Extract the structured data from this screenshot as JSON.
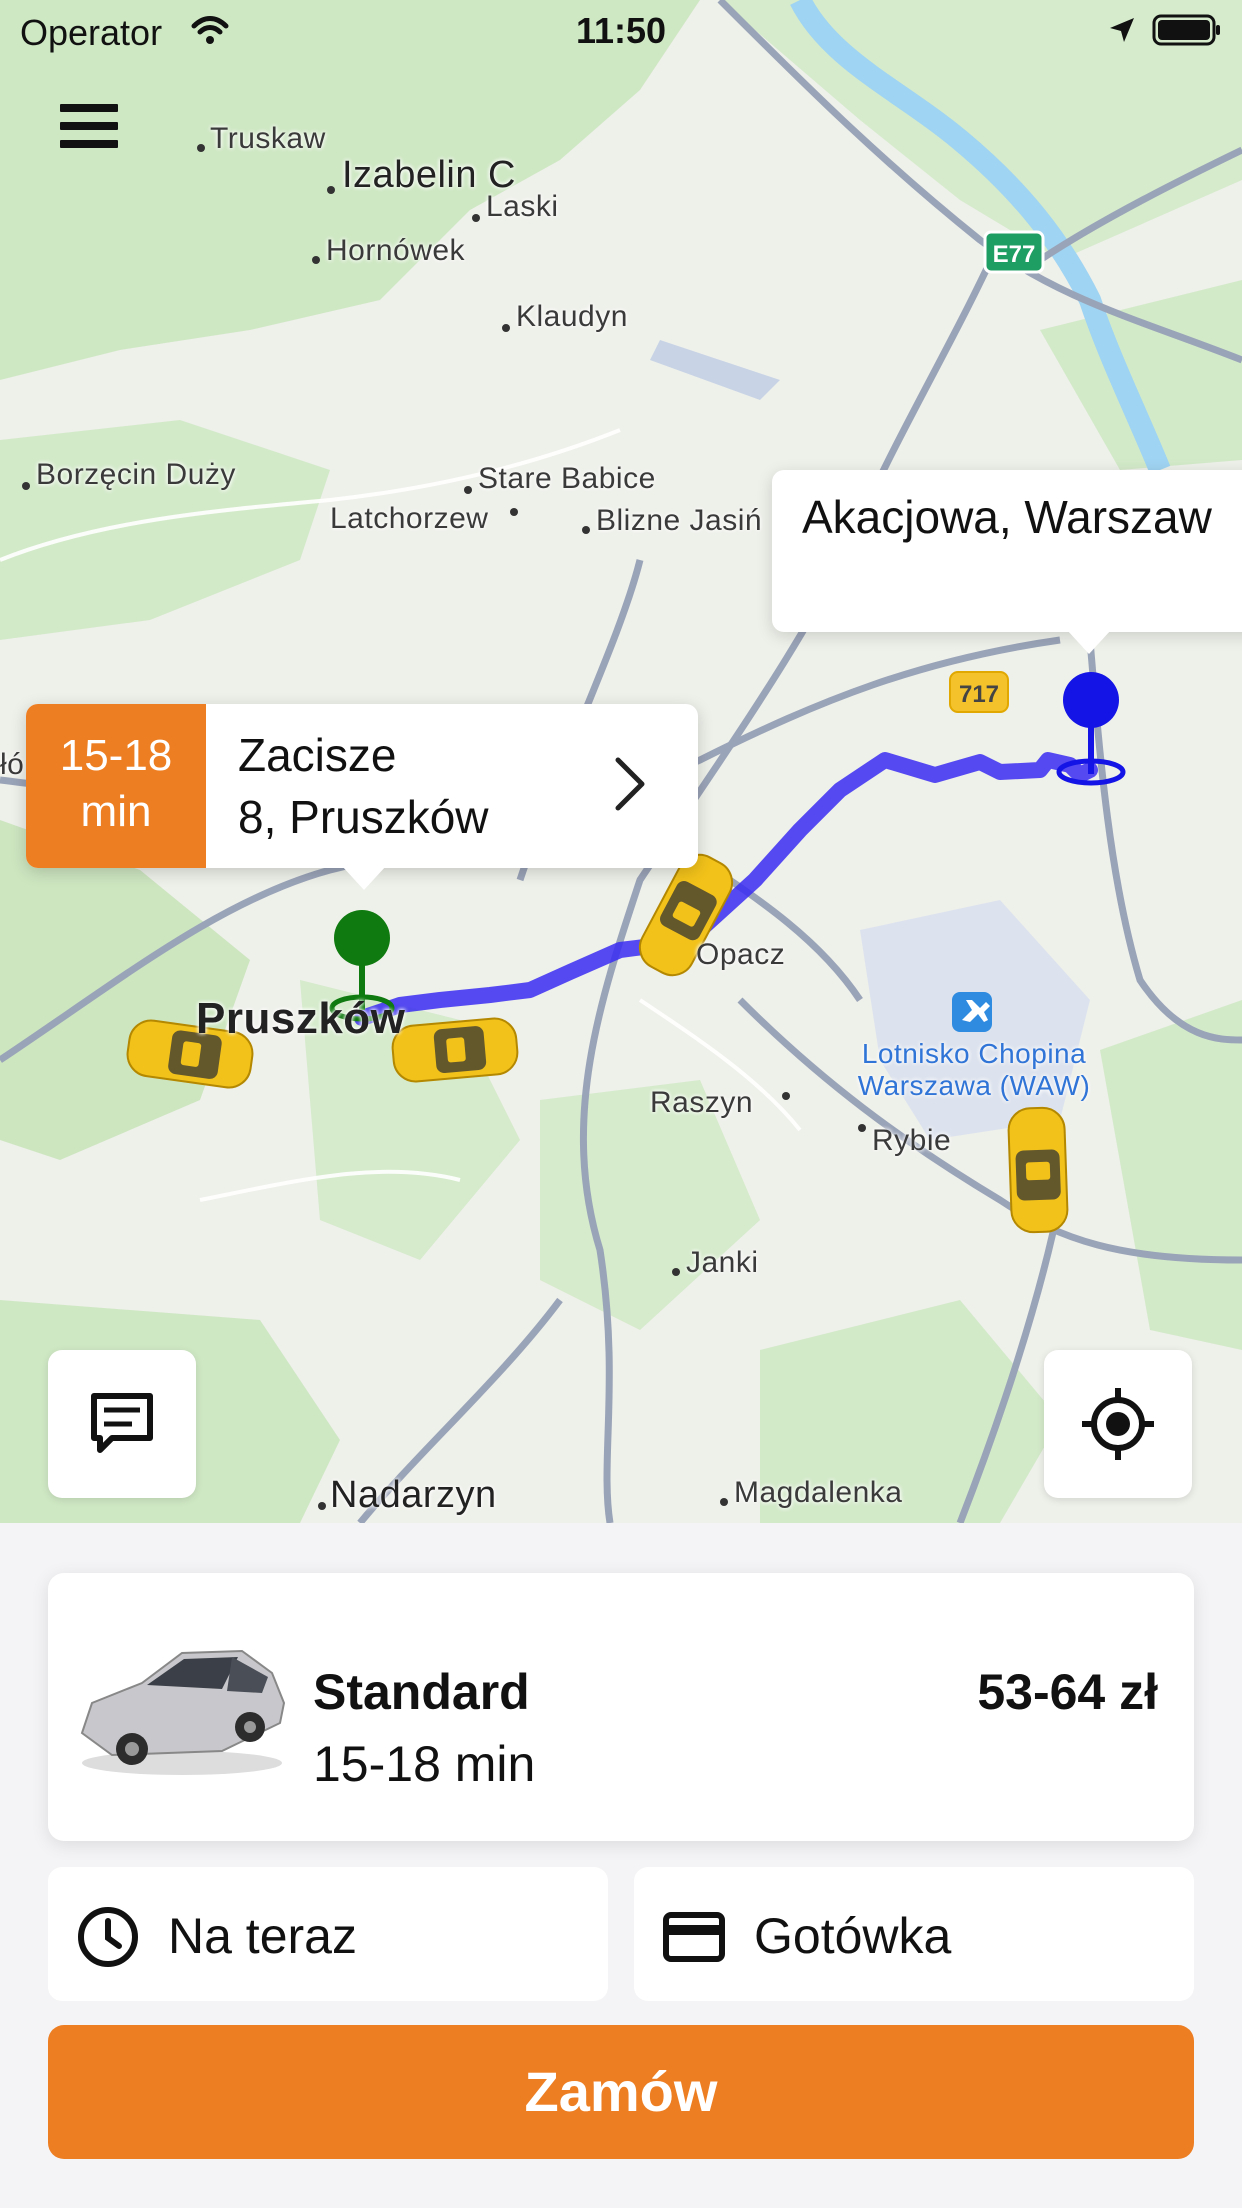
{
  "status_bar": {
    "carrier": "Operator",
    "time": "11:50"
  },
  "map": {
    "places": [
      "Truskaw",
      "Izabelin C",
      "Laski",
      "Hornówek",
      "Klaudyn",
      "Borzęcin Duży",
      "Stare Babice",
      "Latchorzew",
      "Blizne Jasiń",
      "Opacz",
      "Pruszków",
      "Raszyn",
      "Rybie",
      "Janki",
      "Nadarzyn",
      "Magdalenka",
      "Lotnisko Chopina Warszawa (WAW)",
      "łó"
    ],
    "road_badges": [
      "E77",
      "717"
    ],
    "destination_bubble": "Akacjowa, Warszaw",
    "origin_bubble": {
      "eta_line1": "15-18",
      "eta_line2": "min",
      "addr_line1": "Zacisze",
      "addr_line2": "8, Pruszków"
    },
    "colors": {
      "route": "#3a2cf2",
      "origin_pin": "#0f7a0f",
      "destination_pin": "#1414e6",
      "accent": "#ee7e22"
    }
  },
  "controls": {
    "menu_icon": "hamburger-icon",
    "chat_icon": "chat-icon",
    "locate_icon": "locate-icon"
  },
  "ride": {
    "class_name": "Standard",
    "eta": "15-18 min",
    "price": "53-64 zł"
  },
  "options": {
    "time_label": "Na teraz",
    "payment_label": "Gotówka"
  },
  "order_button": "Zamów"
}
